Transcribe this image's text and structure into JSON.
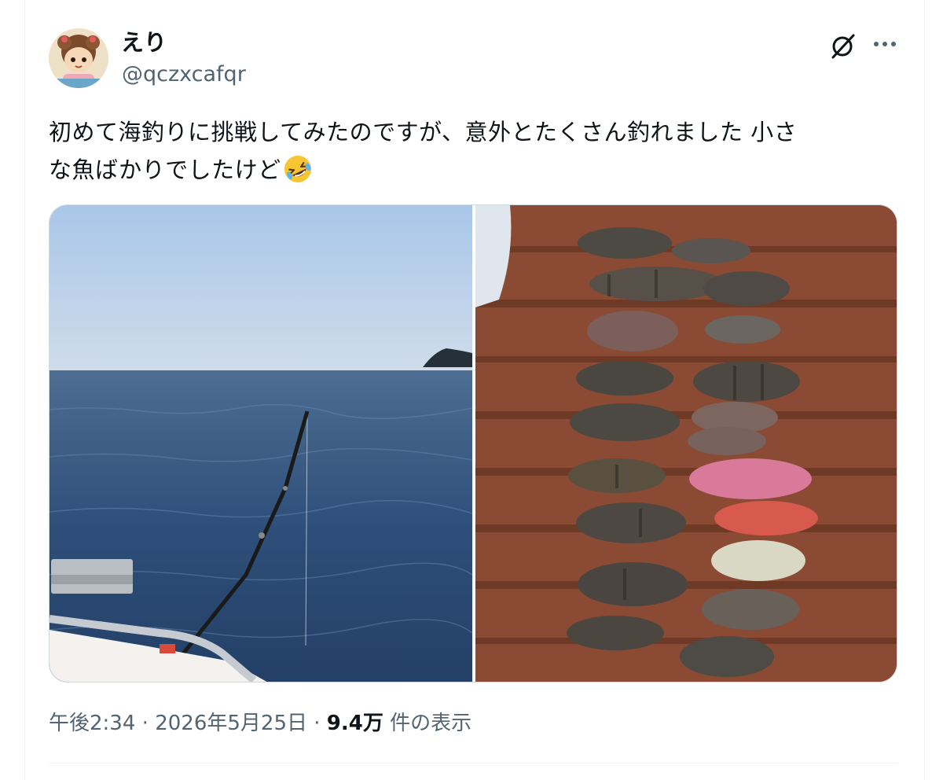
{
  "author": {
    "display_name": "えり",
    "handle": "@qczxcafqr"
  },
  "tweet": {
    "text_line1": "初めて海釣りに挑戦してみたのですが、意外とたくさん釣れました 小さ",
    "text_line2": "な魚ばかりでしたけど",
    "emoji": "rolling-on-floor-laughing"
  },
  "media": [
    {
      "alt": "sea-fishing-rod-photo"
    },
    {
      "alt": "caught-fish-on-deck-photo"
    }
  ],
  "meta": {
    "time": "午後2:34",
    "separator": "·",
    "date": "2026年5月25日",
    "views_count": "9.4万",
    "views_label": "件の表示"
  },
  "icons": {
    "grok": "grok-icon",
    "more": "more-icon"
  }
}
